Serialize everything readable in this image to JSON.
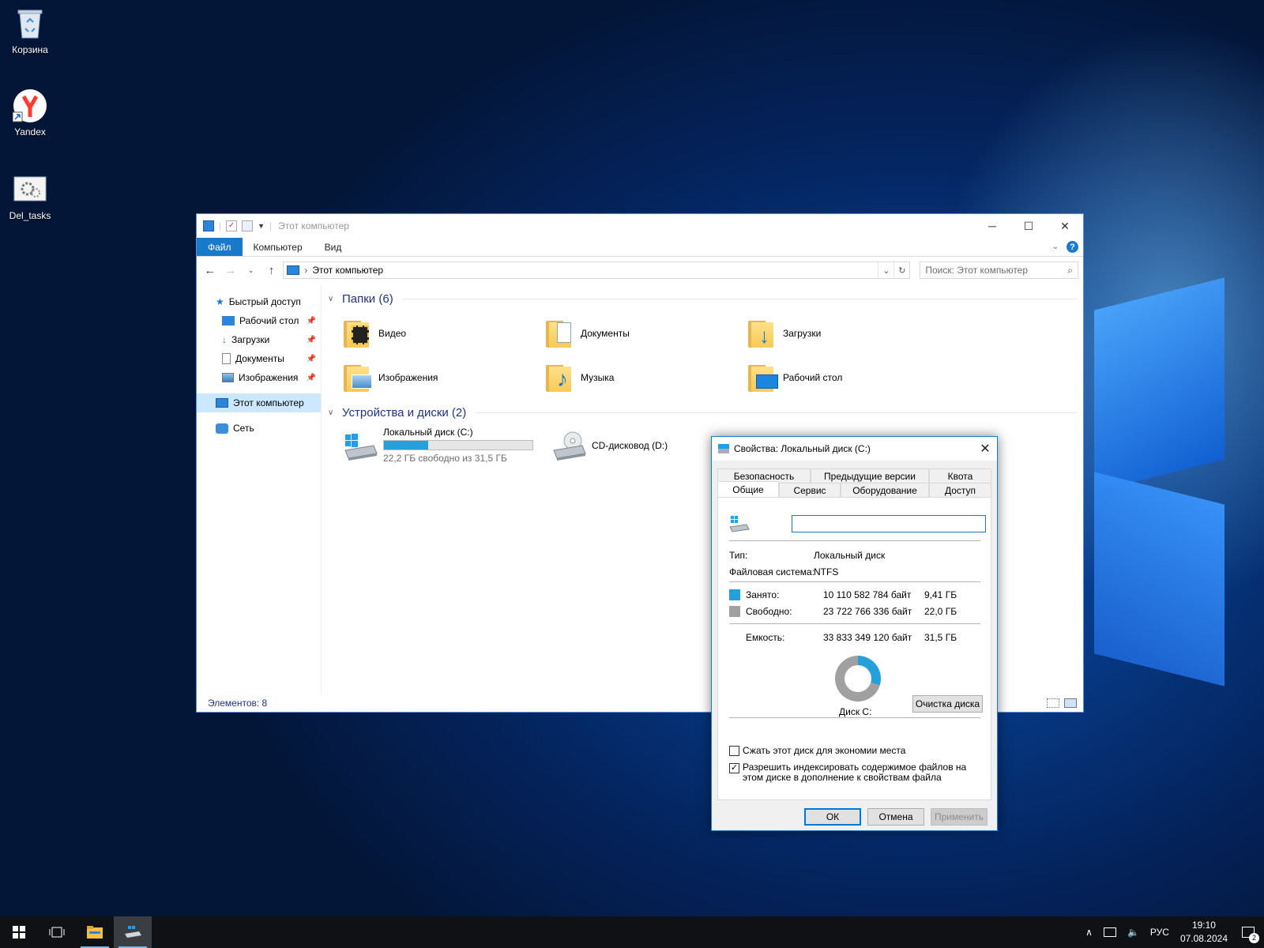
{
  "desktop": {
    "icons": [
      {
        "label": "Корзина"
      },
      {
        "label": "Yandex"
      },
      {
        "label": "Del_tasks"
      }
    ]
  },
  "explorer": {
    "title": "Этот компьютер",
    "ribbon_tabs": [
      "Файл",
      "Компьютер",
      "Вид"
    ],
    "address": "Этот компьютер",
    "search_placeholder": "Поиск: Этот компьютер",
    "nav": {
      "quick_access": "Быстрый доступ",
      "quick_items": [
        "Рабочий стол",
        "Загрузки",
        "Документы",
        "Изображения"
      ],
      "this_pc": "Этот компьютер",
      "network": "Сеть"
    },
    "folders_header": "Папки (6)",
    "folders": [
      "Видео",
      "Документы",
      "Загрузки",
      "Изображения",
      "Музыка",
      "Рабочий стол"
    ],
    "devices_header": "Устройства и диски (2)",
    "drives": [
      {
        "name": "Локальный диск (C:)",
        "free_text": "22,2 ГБ свободно из 31,5 ГБ",
        "used_fraction": 0.296
      },
      {
        "name": "CD-дисковод (D:)"
      }
    ],
    "status": "Элементов: 8"
  },
  "properties": {
    "title": "Свойства: Локальный диск (C:)",
    "tabs_row1": [
      "Безопасность",
      "Предыдущие версии",
      "Квота"
    ],
    "tabs_row2": [
      "Общие",
      "Сервис",
      "Оборудование",
      "Доступ"
    ],
    "name_value": "",
    "type_label": "Тип:",
    "type_value": "Локальный диск",
    "fs_label": "Файловая система:",
    "fs_value": "NTFS",
    "used_label": "Занято:",
    "used_bytes": "10 110 582 784 байт",
    "used_gb": "9,41 ГБ",
    "free_label": "Свободно:",
    "free_bytes": "23 722 766 336 байт",
    "free_gb": "22,0 ГБ",
    "capacity_label": "Емкость:",
    "capacity_bytes": "33 833 349 120 байт",
    "capacity_gb": "31,5 ГБ",
    "disk_label": "Диск С:",
    "cleanup_button": "Очистка диска",
    "compress_label": "Сжать этот диск для экономии места",
    "compress_checked": false,
    "index_label": "Разрешить индексировать содержимое файлов на этом диске в дополнение к свойствам файла",
    "index_checked": true,
    "ok": "ОК",
    "cancel": "Отмена",
    "apply": "Применить",
    "used_color": "#26a0da",
    "free_color": "#a0a0a0"
  },
  "taskbar": {
    "language": "РУС",
    "time": "19:10",
    "date": "07.08.2024",
    "notifications": "2"
  }
}
